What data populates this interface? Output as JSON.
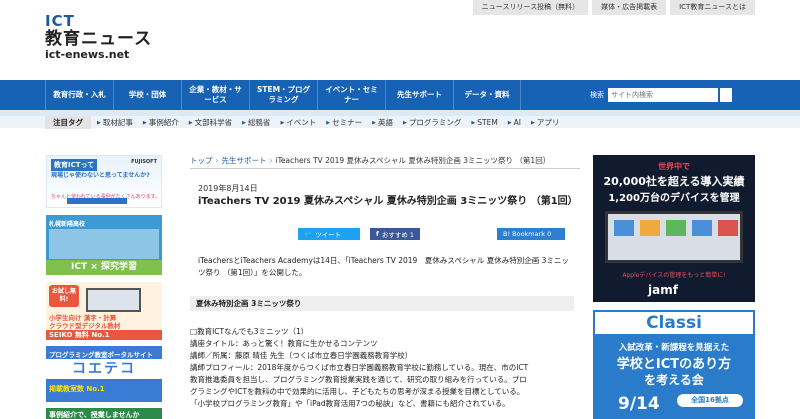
{
  "header": {
    "logo_line1": "ICT",
    "logo_line2": "教育ニュース",
    "logo_line3": "ict-enews.net",
    "top_links": [
      "ニュースリリース投稿（無料）",
      "媒体・広告掲載表",
      "ICT教育ニュースとは"
    ]
  },
  "nav": {
    "items": [
      "教育行政・入札",
      "学校・団体",
      "企業・教材・サービス",
      "STEM・プログラミング",
      "イベント・セミナー",
      "先生サポート",
      "データ・資料"
    ],
    "search_label": "検索",
    "search_placeholder": "サイト内検索"
  },
  "tags": {
    "label": "注目タグ",
    "items": [
      "取材記事",
      "事例紹介",
      "文部科学省",
      "総務省",
      "イベント",
      "セミナー",
      "英語",
      "プログラミング",
      "STEM",
      "AI",
      "アプリ"
    ]
  },
  "left_ads": {
    "b1_title": "教育ICTって",
    "b1_line1": "現場じゃ使わないと思ってませんか?",
    "b1_line2": "ちゃんと使われている事例がたくさんあります。",
    "b1_brand": "FUJISOFT",
    "b2_top": "札幌新陽高校",
    "b2_bottom": "ICT × 探究学習",
    "b3_badge": "お試し無料!",
    "b3_line1": "小学生向け 漢字・計算",
    "b3_line2": "クラウド型デジタル教材",
    "b3_strip": "SEIKO 無料 No.1",
    "b4_title": "プログラミング教室ポータルサイト",
    "b4_big": "コエテコ",
    "b4_sub": "掲載教室数 No.1",
    "b5": "事例紹介で、授業しませんか"
  },
  "breadcrumb": {
    "home": "トップ",
    "category": "先生サポート",
    "current": "iTeachers TV 2019 夏休みスペシャル 夏休み特別企画 3ミニッツ祭り （第1回）"
  },
  "article": {
    "date": "2019年8月14日",
    "title": "iTeachers TV 2019 夏休みスペシャル 夏休み特別企画 3ミニッツ祭り （第1回）",
    "tweet": "ツイート",
    "facebook": "おすすめ 1",
    "hatena": "B! Bookmark 0",
    "intro": "iTeachersとiTeachers Academyは14日、「iTeachers TV 2019　夏休みスペシャル 夏休み特別企画 3ミニッツ祭り （第1回）」を公開した。",
    "section_heading": "夏休み特別企画 3ミニッツ祭り",
    "body_lines": [
      "□教育ICTなんでも3ミニッツ（1）",
      "講座タイトル：あっと驚く！教育に生かせるコンテンツ",
      "講師／所属：藤原 晴佳 先生（つくば市立春日学園義務教育学校）",
      "講師プロフィール：2018年度からつくば市立春日学園義務教育学校に勤務している。現在、市のICT",
      "教育推進委員を担当し、プログラミング教育授業実践を通じて、研究の取り組みを行っている。プロ",
      "グラミングやICTを教科の中で効果的に活用し、子どもたちの思考が深まる授業を目標としている。",
      "「小学校プログラミング教育」や「iPad教育活用7つの秘訣」など、書籍にも紹介されている。"
    ]
  },
  "right_ads": {
    "ad1_head": "世界中で",
    "ad1_line1": "20,000社を超える導入実績",
    "ad1_line2": "1,200万台のデバイスを管理",
    "ad1_note": "Appleデバイスの管理をもっと簡単に!",
    "ad1_brand": "jamf",
    "ad2_brand": "Classi",
    "ad2_line1": "入試改革・新課程を見据えた",
    "ad2_line2": "学校とICTのあり方",
    "ad2_line3": "を考える会",
    "ad2_date": "9/14",
    "ad2_tour": "全国16拠点"
  }
}
